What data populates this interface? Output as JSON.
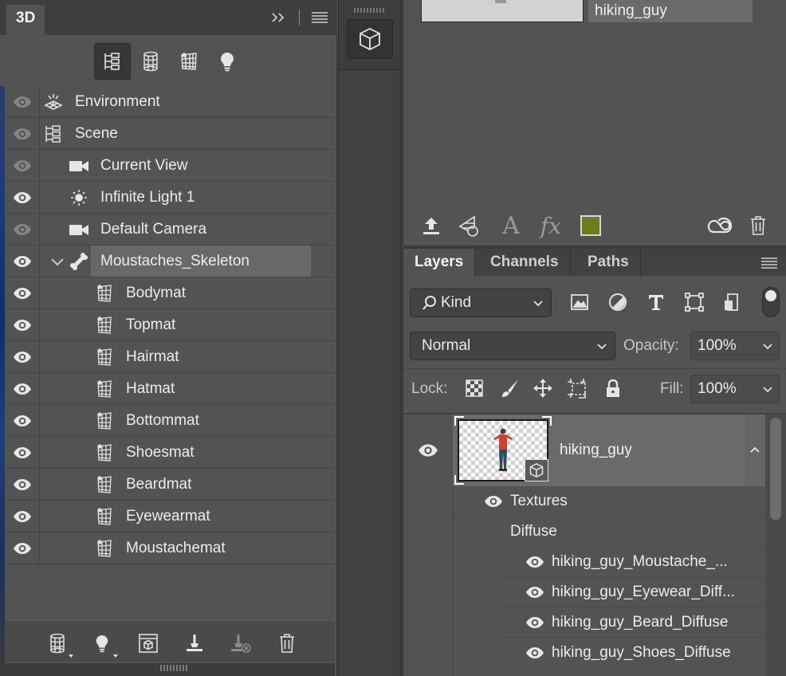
{
  "panel3d": {
    "tab_label": "3D",
    "filter_buttons": [
      "whole-scene-icon",
      "meshes-icon",
      "materials-icon",
      "lights-icon"
    ],
    "tree": [
      {
        "label": "Environment",
        "icon": "environment-icon",
        "indent": 0,
        "eye_dim": true
      },
      {
        "label": "Scene",
        "icon": "scene-icon",
        "indent": 0,
        "eye_dim": true
      },
      {
        "label": "Current View",
        "icon": "camera-icon",
        "indent": 1,
        "eye_dim": true
      },
      {
        "label": "Infinite Light 1",
        "icon": "light-icon",
        "indent": 1,
        "eye_dim": false
      },
      {
        "label": "Default Camera",
        "icon": "camera-icon",
        "indent": 1,
        "eye_dim": true
      },
      {
        "label": "Moustaches_Skeleton",
        "icon": "bone-icon",
        "indent": 1,
        "eye_dim": false,
        "selected": true,
        "expanded": true
      },
      {
        "label": "Bodymat",
        "icon": "material-icon",
        "indent": 2
      },
      {
        "label": "Topmat",
        "icon": "material-icon",
        "indent": 2
      },
      {
        "label": "Hairmat",
        "icon": "material-icon",
        "indent": 2
      },
      {
        "label": "Hatmat",
        "icon": "material-icon",
        "indent": 2
      },
      {
        "label": "Bottommat",
        "icon": "material-icon",
        "indent": 2
      },
      {
        "label": "Shoesmat",
        "icon": "material-icon",
        "indent": 2
      },
      {
        "label": "Beardmat",
        "icon": "material-icon",
        "indent": 2
      },
      {
        "label": "Eyewearmat",
        "icon": "material-icon",
        "indent": 2
      },
      {
        "label": "Moustachemat",
        "icon": "material-icon",
        "indent": 2
      }
    ],
    "bottom_buttons": [
      "add-mesh-icon",
      "add-light-icon",
      "render-icon",
      "drop-to-ground-icon",
      "remove-from-ground-icon",
      "trash-icon"
    ]
  },
  "properties": {
    "layer_name": "hiking_guy",
    "swatch_color": "#6c7c1e"
  },
  "layers": {
    "tabs": [
      "Layers",
      "Channels",
      "Paths"
    ],
    "active_tab": "Layers",
    "filter_kind": "Kind",
    "blend_mode": "Normal",
    "opacity_label": "Opacity:",
    "opacity_value": "100%",
    "lock_label": "Lock:",
    "fill_label": "Fill:",
    "fill_value": "100%",
    "layer": {
      "name": "hiking_guy",
      "textures_label": "Textures",
      "group_label": "Diffuse",
      "textures": [
        "hiking_guy_Moustache_...",
        "hiking_guy_Eyewear_Diff...",
        "hiking_guy_Beard_Diffuse",
        "hiking_guy_Shoes_Diffuse"
      ]
    }
  }
}
